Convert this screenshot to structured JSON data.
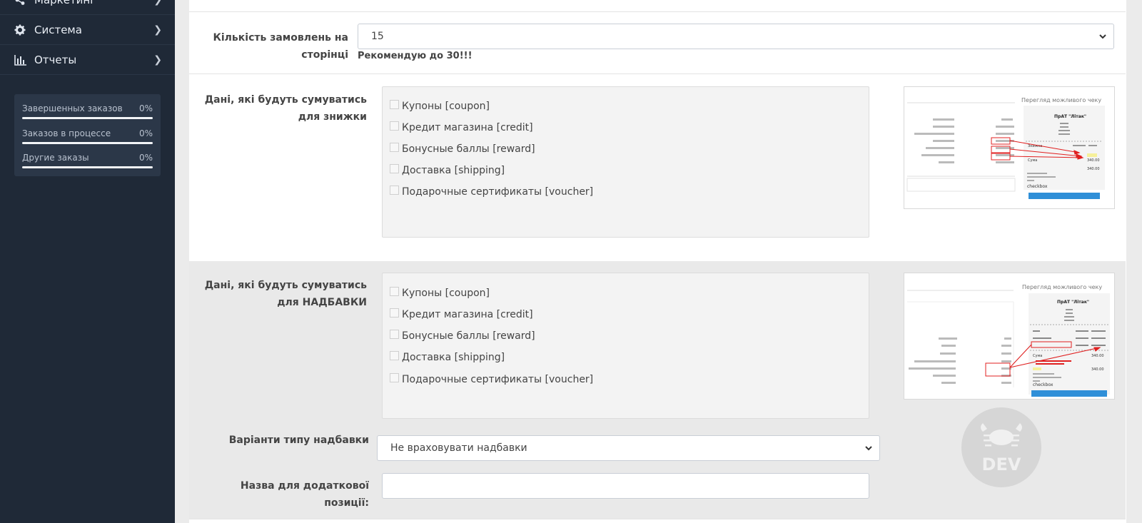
{
  "sidebar": {
    "items": [
      {
        "label": "Маркетинг",
        "icon": "share-icon"
      },
      {
        "label": "Система",
        "icon": "gear-icon"
      },
      {
        "label": "Отчеты",
        "icon": "bar-chart-icon"
      }
    ],
    "stats": [
      {
        "label": "Завершенных заказов",
        "value": "0%",
        "progress": 0
      },
      {
        "label": "Заказов в процессе",
        "value": "0%",
        "progress": 0
      },
      {
        "label": "Другие заказы",
        "value": "0%",
        "progress": 0
      }
    ]
  },
  "form": {
    "orders_per_page": {
      "label": "Кількість замовлень на сторінці",
      "value": "15",
      "hint": "Рекомендую до 30!!!"
    },
    "discount_section": {
      "label": "Дані, які будуть сумуватись для знижки",
      "options": [
        "Купоны [coupon]",
        "Кредит магазина [credit]",
        "Бонусные баллы [reward]",
        "Доставка [shipping]",
        "Подарочные сертификаты [voucher]"
      ],
      "preview": {
        "title": "Перегляд можливого чеку",
        "company": "ПрАТ \"Літак\"",
        "brand": "checkbox",
        "labels": [
          "Знижка",
          "Сума"
        ],
        "amounts": [
          "340.00",
          "340.00"
        ]
      }
    },
    "markup_section": {
      "label": "Дані, які будуть сумуватись для НАДБАВКИ",
      "options": [
        "Купоны [coupon]",
        "Кредит магазина [credit]",
        "Бонусные баллы [reward]",
        "Доставка [shipping]",
        "Подарочные сертификаты [voucher]"
      ],
      "preview": {
        "title": "Перегляд можливого чеку",
        "company": "ПрАТ \"Літак\"",
        "brand": "checkbox",
        "labels": [
          "Сума"
        ],
        "amounts": [
          "340.00",
          "340.00"
        ]
      }
    },
    "markup_type": {
      "label": "Варіанти типу надбавки",
      "value": "Не враховувати надбавки"
    },
    "extra_position_name": {
      "label": "Назва для додаткової позиції:",
      "value": ""
    }
  },
  "watermark": {
    "text": "DEV",
    "icon": "crab-icon"
  },
  "colors": {
    "sidebar": "#1f2937",
    "panel_gray": "#e8e8e8",
    "accent_blue": "#2f8fd8",
    "arrow_red": "#e02020"
  }
}
